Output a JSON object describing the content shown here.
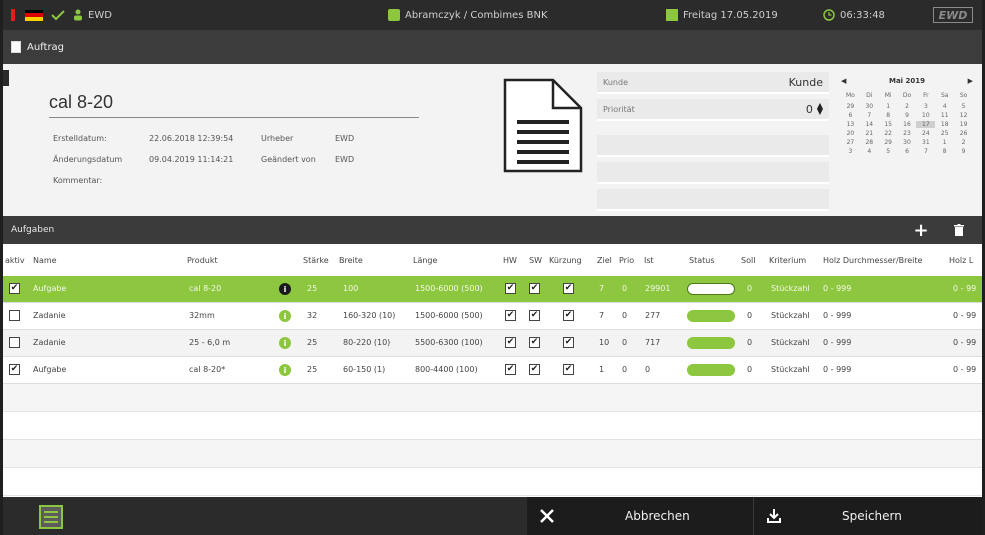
{
  "topbar": {
    "user": "EWD",
    "company": "Abramczyk / Combimes BNK",
    "date": "Freitag  17.05.2019",
    "time": "06:33:48",
    "logo": "EWD",
    "colors": {
      "accent": "#8dc63f",
      "alert": "#e02020"
    }
  },
  "window": {
    "title": "Auftrag"
  },
  "order": {
    "title": "cal 8-20",
    "created_label": "Erstelldatum:",
    "created_value": "22.06.2018 12:39:54",
    "author_label": "Urheber",
    "author_value": "EWD",
    "modified_label": "Änderungsdatum",
    "modified_value": "09.04.2019 11:14:21",
    "changed_by_label": "Geändert von",
    "changed_by_value": "EWD",
    "comment_label": "Kommentar:",
    "customer_label": "Kunde",
    "customer_value": "Kunde",
    "priority_label": "Priorität",
    "priority_value": "0"
  },
  "calendar": {
    "month": "Mai 2019",
    "weekdays": [
      "Mo",
      "Di",
      "Mi",
      "Do",
      "Fr",
      "Sa",
      "So"
    ],
    "days": [
      "29",
      "30",
      "1",
      "2",
      "3",
      "4",
      "5",
      "6",
      "7",
      "8",
      "9",
      "10",
      "11",
      "12",
      "13",
      "14",
      "15",
      "16",
      "17",
      "18",
      "19",
      "20",
      "21",
      "22",
      "23",
      "24",
      "25",
      "26",
      "27",
      "28",
      "29",
      "30",
      "31",
      "1",
      "2",
      "3",
      "4",
      "5",
      "6",
      "7",
      "8",
      "9"
    ],
    "selected_index": 18
  },
  "section": {
    "title": "Aufgaben"
  },
  "table": {
    "headers": {
      "active": "aktiv",
      "name": "Name",
      "product": "Produkt",
      "thickness": "Stärke",
      "width": "Breite",
      "length": "Länge",
      "hw": "HW",
      "sw": "SW",
      "cut": "Kürzung",
      "target": "Ziel",
      "prio": "Prio",
      "actual": "Ist",
      "status": "Status",
      "target2": "Soll",
      "criterion": "Kriterium",
      "wood_diameter": "Holz Durchmesser/Breite",
      "wood_length": "Holz L"
    },
    "rows": [
      {
        "active": true,
        "name": "Aufgabe",
        "product": "cal 8-20",
        "info_color": "#1a1a1a",
        "thickness": "25",
        "width": "100",
        "length": "1500-6000 (500)",
        "hw": true,
        "sw": true,
        "cut": true,
        "target": "7",
        "prio": "0",
        "actual": "29901",
        "status_fill": 0,
        "target2": "0",
        "criterion": "Stückzahl",
        "wood_diameter": "0 - 999",
        "wood_length": "0 - 99",
        "selected": true
      },
      {
        "active": false,
        "name": "Zadanie",
        "product": "32mm",
        "info_color": "#8dc63f",
        "thickness": "32",
        "width": "160-320 (10)",
        "length": "1500-6000 (500)",
        "hw": true,
        "sw": true,
        "cut": true,
        "target": "7",
        "prio": "0",
        "actual": "277",
        "status_fill": 1,
        "target2": "0",
        "criterion": "Stückzahl",
        "wood_diameter": "0 - 999",
        "wood_length": "0 - 99",
        "selected": false
      },
      {
        "active": false,
        "name": "Zadanie",
        "product": "25 - 6,0 m",
        "info_color": "#8dc63f",
        "thickness": "25",
        "width": "80-220 (10)",
        "length": "5500-6300 (100)",
        "hw": true,
        "sw": true,
        "cut": true,
        "target": "10",
        "prio": "0",
        "actual": "717",
        "status_fill": 1,
        "target2": "0",
        "criterion": "Stückzahl",
        "wood_diameter": "0 - 999",
        "wood_length": "0 - 99",
        "selected": false
      },
      {
        "active": true,
        "name": "Aufgabe",
        "product": "cal 8-20*",
        "info_color": "#8dc63f",
        "thickness": "25",
        "width": "60-150 (1)",
        "length": "800-4400 (100)",
        "hw": true,
        "sw": true,
        "cut": true,
        "target": "1",
        "prio": "0",
        "actual": "0",
        "status_fill": 1,
        "target2": "0",
        "criterion": "Stückzahl",
        "wood_diameter": "0 - 999",
        "wood_length": "0 - 99",
        "selected": false
      }
    ]
  },
  "bottom": {
    "cancel_label": "Abbrechen",
    "save_label": "Speichern"
  }
}
